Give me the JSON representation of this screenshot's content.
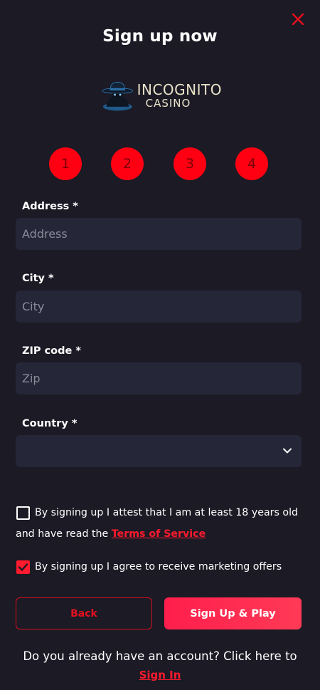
{
  "header": {
    "title": "Sign up now"
  },
  "logo": {
    "line1": "INCOGNITO",
    "line2": "CASINO"
  },
  "steps": [
    "1",
    "2",
    "3",
    "4"
  ],
  "form": {
    "address": {
      "label": "Address *",
      "placeholder": "Address",
      "value": ""
    },
    "city": {
      "label": "City *",
      "placeholder": "City",
      "value": ""
    },
    "zip": {
      "label": "ZIP code *",
      "placeholder": "Zip",
      "value": ""
    },
    "country": {
      "label": "Country *",
      "selected": ""
    }
  },
  "consent": {
    "age": {
      "text": "By signing up I attest that I am at least 18 years old",
      "text2": "and have read the ",
      "link": "Terms of Service",
      "checked": false
    },
    "marketing": {
      "text": "By signing up I agree to receive marketing offers",
      "checked": true
    }
  },
  "buttons": {
    "back": "Back",
    "signup": "Sign Up & Play"
  },
  "footer": {
    "text": "Do you already have an account? Click here to",
    "link": "Sign In"
  },
  "colors": {
    "background": "#1b1a25",
    "accent": "#ff1a2e",
    "input": "#252637"
  }
}
